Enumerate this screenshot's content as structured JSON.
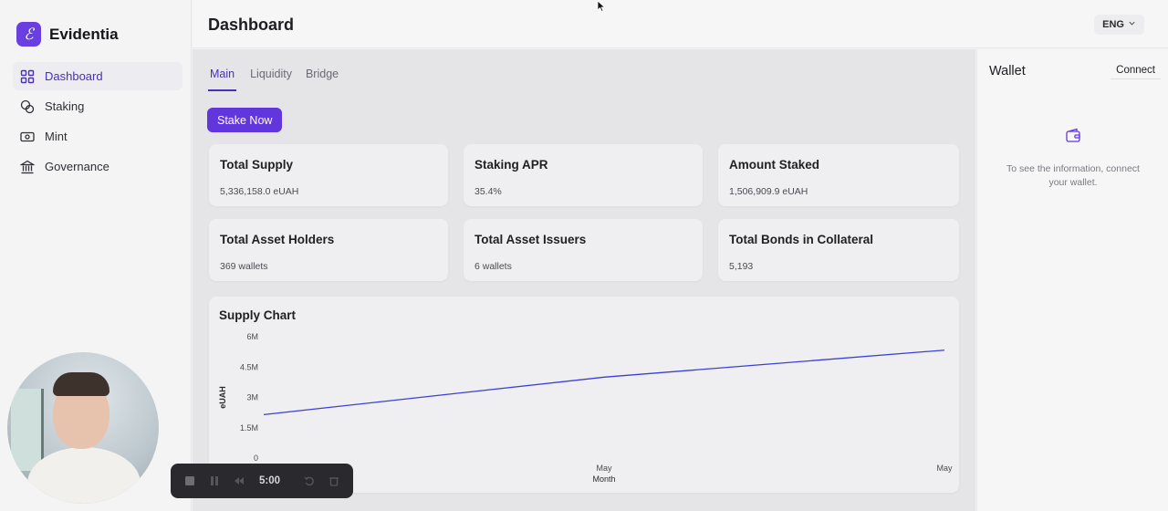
{
  "brand": {
    "name": "Evidentia",
    "logo_letter": "ℰ",
    "accent": "#6a3fe0"
  },
  "sidebar": {
    "items": [
      {
        "label": "Dashboard",
        "icon": "grid-icon",
        "active": true
      },
      {
        "label": "Staking",
        "icon": "coins-icon",
        "active": false
      },
      {
        "label": "Mint",
        "icon": "banknote-icon",
        "active": false
      },
      {
        "label": "Governance",
        "icon": "landmark-icon",
        "active": false
      }
    ]
  },
  "header": {
    "title": "Dashboard",
    "language": "ENG"
  },
  "tabs": [
    {
      "label": "Main",
      "active": true
    },
    {
      "label": "Liquidity",
      "active": false
    },
    {
      "label": "Bridge",
      "active": false
    }
  ],
  "stake_button": "Stake Now",
  "stats": [
    {
      "title": "Total Supply",
      "value": "5,336,158.0 eUAH"
    },
    {
      "title": "Staking APR",
      "value": "35.4%"
    },
    {
      "title": "Amount Staked",
      "value": "1,506,909.9 eUAH"
    },
    {
      "title": "Total Asset Holders",
      "value": "369 wallets"
    },
    {
      "title": "Total Asset Issuers",
      "value": "6 wallets"
    },
    {
      "title": "Total Bonds in Collateral",
      "value": "5,193"
    }
  ],
  "chart_data": {
    "type": "line",
    "title": "Supply Chart",
    "xlabel": "Month",
    "ylabel": "eUAH",
    "y_ticks": [
      "0",
      "1.5M",
      "3M",
      "4.5M",
      "6M"
    ],
    "ylim": [
      0,
      6000000
    ],
    "x_tick_labels": [
      "May",
      "May"
    ],
    "x": [
      0,
      0.5,
      1
    ],
    "series": [
      {
        "values": [
          2150000,
          4000000,
          5336158
        ],
        "color": "#3b3fd8"
      }
    ],
    "grid": false
  },
  "wallet": {
    "title": "Wallet",
    "connect_label": "Connect",
    "message": "To see the information, connect your wallet."
  },
  "recording": {
    "time": "5:00"
  }
}
